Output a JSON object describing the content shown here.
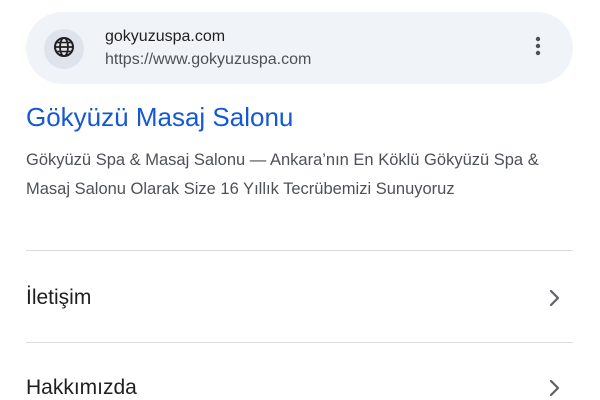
{
  "site": {
    "name": "gokyuzuspa.com",
    "url": "https://www.gokyuzuspa.com"
  },
  "result": {
    "title": "Gökyüzü Masaj Salonu",
    "snippet": "Gökyüzü Spa & Masaj Salonu — Ankara’nın En Köklü Gökyüzü Spa & Masaj Salonu Olarak Size 16 Yıllık Tecrübemizi Sunuyoruz"
  },
  "sitelinks": [
    {
      "label": "İletişim",
      "icon": "chevron-right-icon"
    },
    {
      "label": "Hakkımızda",
      "icon": "chevron-right-icon"
    }
  ],
  "icons": {
    "site": "globe-icon",
    "menu": "more-vert-icon"
  },
  "colors": {
    "title_link": "#1558d6",
    "header_bg": "#f0f4f9",
    "text_secondary": "#4d5156",
    "text_primary": "#1f1f1f",
    "divider": "#dadce0"
  }
}
